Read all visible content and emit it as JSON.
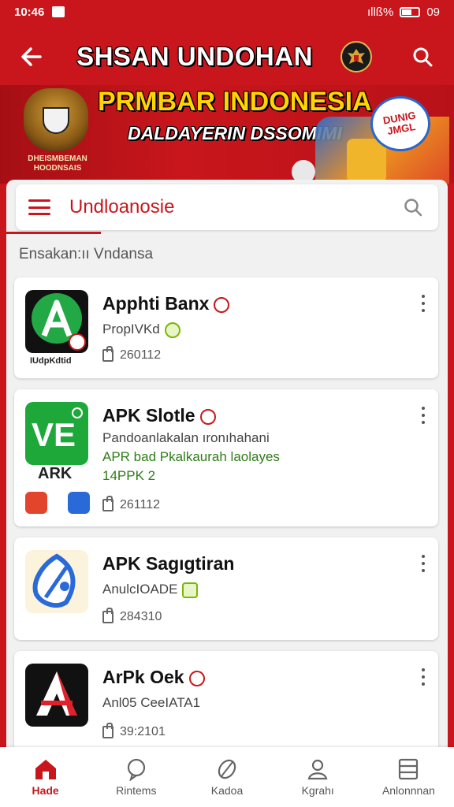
{
  "status_bar": {
    "time": "10:46",
    "signal_text": "ıllß%",
    "battery_text": "09"
  },
  "header": {
    "title": "SHSAN UNDOHAN",
    "icons": [
      "back-arrow-icon",
      "emblem-icon",
      "search-icon"
    ]
  },
  "banner": {
    "headline": "PRMBAR INDONESIA",
    "subline": "DALDAYERIN DSSOMIMI",
    "emblem_caption": "DHEISMBEMAN HOODNSAIS",
    "badge_text": "DUNIG JMGL"
  },
  "search": {
    "query": "Undloanosie"
  },
  "section": {
    "label": "Ensakan:ıı Vndansa"
  },
  "apps": [
    {
      "name": "Apphti Banx",
      "desc": "PropIVKd",
      "meta": "260112",
      "icon_label": "IUdpKdtid"
    },
    {
      "name": "APK Slotle",
      "desc": "Pandoanlakalan ıronıhahani",
      "desc2": "APR bad Pkalkaurah laolayes",
      "desc3": "14PPK 2",
      "meta": "261112",
      "icon_label": "ARK"
    },
    {
      "name": "APK Sagıgtiran",
      "desc": "AnulcIOADE",
      "meta": "284310"
    },
    {
      "name": "ArPk Oek",
      "desc": "Anl05 CeeIATA1",
      "meta": "39:2101"
    }
  ],
  "bottom_nav": [
    {
      "label": "Hade",
      "icon": "home-icon",
      "active": true
    },
    {
      "label": "Rintems",
      "icon": "chat-bubble-icon",
      "active": false
    },
    {
      "label": "Kadoa",
      "icon": "leaf-icon",
      "active": false
    },
    {
      "label": "Kgrahı",
      "icon": "profile-icon",
      "active": false
    },
    {
      "label": "Anlonnnan",
      "icon": "list-icon",
      "active": false
    }
  ],
  "colors": {
    "brand_red": "#c8161c",
    "headline_yellow": "#ffd500",
    "desc_green": "#2f7d18"
  }
}
